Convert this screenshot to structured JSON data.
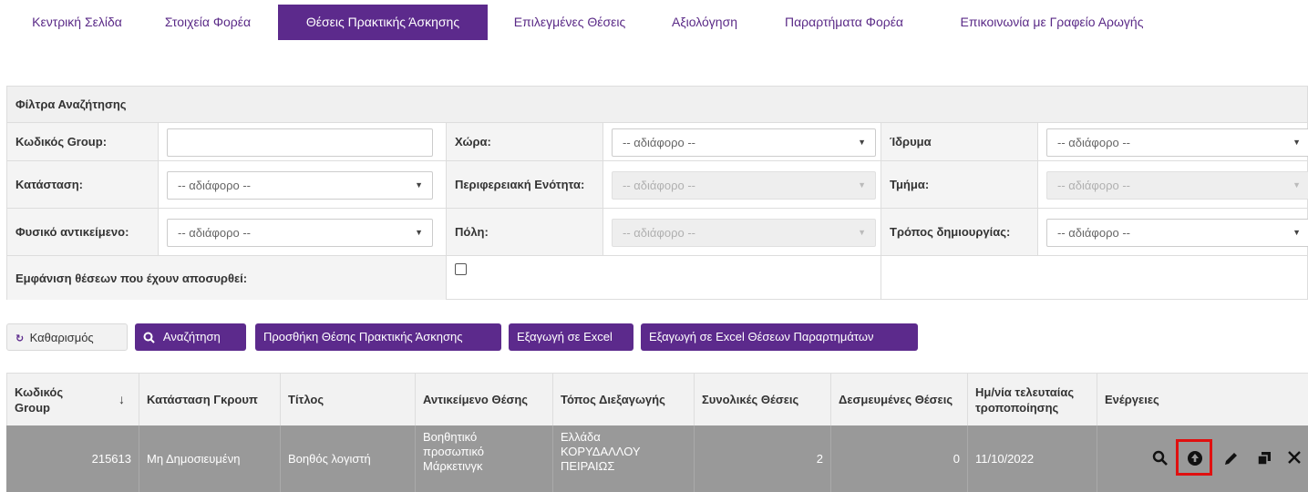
{
  "nav": {
    "tabs": [
      {
        "label": "Κεντρική Σελίδα"
      },
      {
        "label": "Στοιχεία Φορέα"
      },
      {
        "label": "Θέσεις Πρακτικής Άσκησης"
      },
      {
        "label": "Επιλεγμένες Θέσεις"
      },
      {
        "label": "Αξιολόγηση"
      },
      {
        "label": "Παραρτήματα Φορέα"
      },
      {
        "label": "Επικοινωνία με Γραφείο Αρωγής"
      }
    ],
    "active_index": 2
  },
  "filters": {
    "title": "Φίλτρα Αναζήτησης",
    "group_code_label": "Κωδικός Group:",
    "group_code_value": "",
    "country_label": "Χώρα:",
    "country_value": "-- αδιάφορο --",
    "institution_label": "Ίδρυμα",
    "institution_value": "-- αδιάφορο --",
    "status_label": "Κατάσταση:",
    "status_value": "-- αδιάφορο --",
    "region_label": "Περιφερειακή Ενότητα:",
    "region_value": "-- αδιάφορο --",
    "department_label": "Τμήμα:",
    "department_value": "-- αδιάφορο --",
    "physical_object_label": "Φυσικό αντικείμενο:",
    "physical_object_value": "-- αδιάφορο --",
    "city_label": "Πόλη:",
    "city_value": "-- αδιάφορο --",
    "creation_method_label": "Τρόπος δημιουργίας:",
    "creation_method_value": "-- αδιάφορο --",
    "show_withdrawn_label": "Εμφάνιση θέσεων που έχουν αποσυρθεί:",
    "show_withdrawn_checked": false
  },
  "buttons": {
    "clear": "Καθαρισμός",
    "search": "Αναζήτηση",
    "add_position": "Προσθήκη Θέσης Πρακτικής Άσκησης",
    "export_excel": "Εξαγωγή σε Excel",
    "export_excel_annexes": "Εξαγωγή σε Excel Θέσεων Παραρτημάτων"
  },
  "table": {
    "columns": [
      "Κωδικός Group",
      "Κατάσταση Γκρουπ",
      "Τίτλος",
      "Αντικείμενο Θέσης",
      "Τόπος Διεξαγωγής",
      "Συνολικές Θέσεις",
      "Δεσμευμένες Θέσεις",
      "Ημ/νία τελευταίας τροποποίησης",
      "Ενέργειες"
    ],
    "rows": [
      {
        "group_code": "215613",
        "status": "Μη Δημοσιευμένη",
        "title": "Βοηθός λογιστή",
        "object_lines": [
          "Βοηθητικό",
          "προσωπικό",
          "Μάρκετινγκ"
        ],
        "place_lines": [
          "Ελλάδα",
          "ΚΟΡΥΔΑΛΛΟΥ",
          "ΠΕΙΡΑΙΩΣ"
        ],
        "total_positions": "2",
        "reserved_positions": "0",
        "last_modified": "11/10/2022"
      }
    ],
    "actions": [
      "search-icon",
      "publish-icon",
      "edit-icon",
      "copy-icon",
      "delete-icon"
    ]
  },
  "colors": {
    "brand_purple": "#5c2a8c",
    "row_grey": "#999999",
    "highlight_red": "#e01010"
  }
}
